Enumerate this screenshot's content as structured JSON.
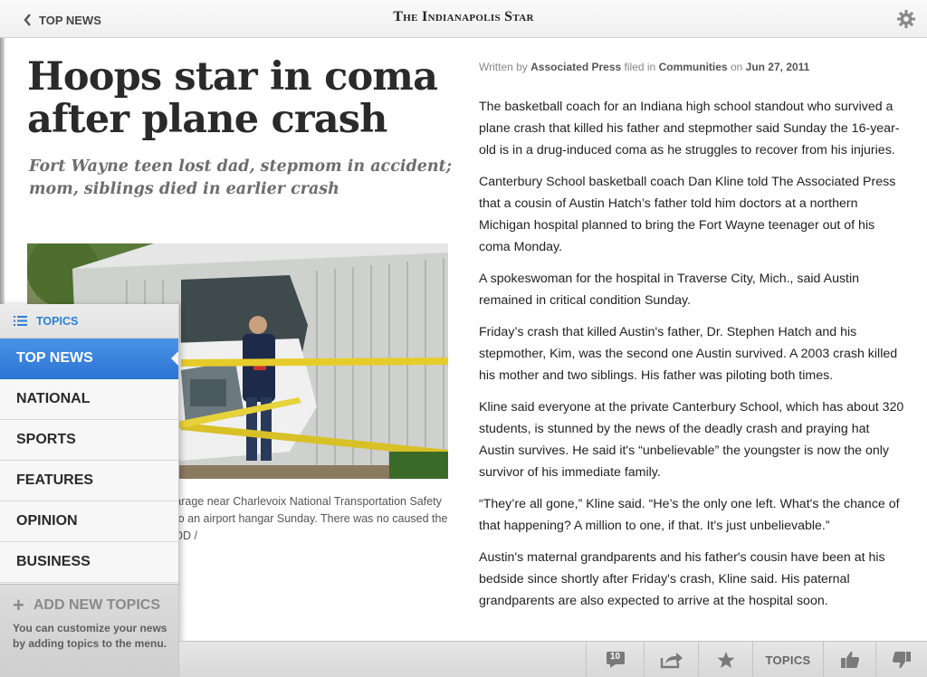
{
  "header": {
    "back_label": "TOP NEWS",
    "masthead": "The Indianapolis Star",
    "settings_icon": "gear-icon"
  },
  "article": {
    "headline": "Hoops star in coma after plane crash",
    "subhead": "Fort Wayne teen lost dad, stepmom in accident; mom, siblings died in earlier crash",
    "byline": {
      "written_by": "Written by",
      "author": "Associated Press",
      "filed_in": "filed in",
      "section": "Communities",
      "on": "on",
      "date": "Jun 27, 2011"
    },
    "caption": "Hatch crashed Friday into a garage near Charlevoix National Transportation Safety Board is investigating moved to an airport hangar Sunday. There was no caused the crash. / HEATHER LOCKWOOD /",
    "paragraphs": [
      "The basketball coach for an Indiana high school standout who survived a plane crash that killed his father and stepmother said Sunday the 16-year-old is in a drug-induced coma as he struggles to recover from his injuries.",
      "Canterbury School basketball coach Dan Kline told The Associated Press that a cousin of Austin Hatch’s father told him doctors at a northern Michigan hospital planned to bring the Fort Wayne teenager out of his coma Monday.",
      "A spokeswoman for the hospital in Traverse City, Mich., said Austin remained in critical condition Sunday.",
      "Friday’s crash that killed Austin's father, Dr. Stephen Hatch and his stepmother, Kim, was the second one Austin survived. A 2003 crash killed his mother and two siblings. His father was piloting both times.",
      "Kline said everyone at the private Canterbury School, which has about 320 students, is stunned by the news of the deadly crash and praying hat Austin survives. He said it's “unbelievable” the youngster is now the only survivor of his immediate family.",
      "“They’re all gone,” Kline said. “He’s the only one left. What's the chance of that happening? A million to one, if that. It's just unbelievable.”",
      "Austin's maternal grandparents and his father's cousin have been at his bedside since shortly after Friday's crash, Kline said. His paternal grandparents are also expected to arrive at the hospital soon."
    ]
  },
  "drawer": {
    "title": "TOPICS",
    "items": [
      {
        "label": "TOP NEWS",
        "active": true
      },
      {
        "label": "NATIONAL"
      },
      {
        "label": "SPORTS"
      },
      {
        "label": "FEATURES"
      },
      {
        "label": "OPINION"
      },
      {
        "label": "BUSINESS"
      }
    ],
    "add_label": "ADD NEW TOPICS",
    "add_desc": "You can customize your news by adding topics to the menu."
  },
  "toolbar": {
    "comments_count": "10",
    "topics_label": "TOPICS",
    "icons": [
      "comment-icon",
      "share-icon",
      "star-icon",
      "thumbs-up-icon",
      "thumbs-down-icon"
    ]
  },
  "colors": {
    "accent": "#2c74d4",
    "drawer_title": "#2a7fd8"
  }
}
